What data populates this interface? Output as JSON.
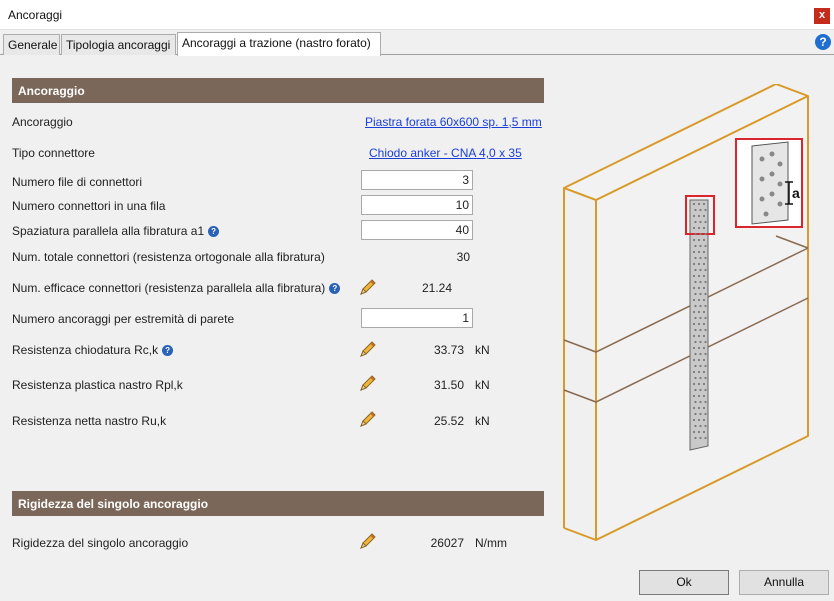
{
  "window": {
    "title": "Ancoraggi",
    "close_glyph": "x"
  },
  "tabs": [
    {
      "label": "Generale"
    },
    {
      "label": "Tipologia ancoraggi"
    },
    {
      "label": "Ancoraggi a trazione (nastro forato)",
      "active": true
    }
  ],
  "help_glyph": "?",
  "section_ancoraggio": {
    "title": "Ancoraggio",
    "ancoraggio_label": "Ancoraggio",
    "ancoraggio_link": "Piastra forata 60x600 sp. 1,5 mm",
    "connettore_label": "Tipo connettore",
    "connettore_link": "Chiodo anker - CNA 4,0 x 35",
    "file_label": "Numero file di connettori",
    "file_value": "3",
    "fila_label": "Numero connettori in una fila",
    "fila_value": "10",
    "spaziatura_label": "Spaziatura parallela alla fibratura a1",
    "spaziatura_value": "40",
    "totale_label": "Num. totale connettori (resistenza ortogonale alla fibratura)",
    "totale_value": "30",
    "efficace_label": "Num. efficace connettori (resistenza parallela alla fibratura)",
    "efficace_value": "21.24",
    "estremita_label": "Numero ancoraggi per estremità di parete",
    "estremita_value": "1",
    "chiodatura_label": "Resistenza chiodatura Rc,k",
    "chiodatura_value": "33.73",
    "chiodatura_unit": "kN",
    "plastica_label": "Resistenza plastica nastro Rpl,k",
    "plastica_value": "31.50",
    "plastica_unit": "kN",
    "netta_label": "Resistenza netta nastro Ru,k",
    "netta_value": "25.52",
    "netta_unit": "kN"
  },
  "section_rigidezza": {
    "title": "Rigidezza del singolo ancoraggio",
    "rigidezza_label": "Rigidezza del singolo ancoraggio",
    "rigidezza_value": "26027",
    "rigidezza_unit": "N/mm"
  },
  "drawing": {
    "detail_label": "a"
  },
  "buttons": {
    "ok": "Ok",
    "cancel": "Annulla"
  },
  "colors": {
    "section_header": "#7a6759",
    "wood_edge": "#d89a2a",
    "highlight": "#d9262c",
    "link": "#1a3fd6"
  },
  "icons": [
    "close-icon",
    "help-icon",
    "info-icon",
    "pencil-icon"
  ]
}
